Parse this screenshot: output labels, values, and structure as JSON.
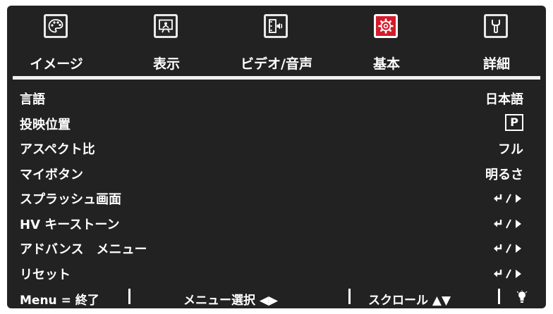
{
  "tabs": [
    {
      "label": "イメージ",
      "icon": "palette-icon",
      "active": false
    },
    {
      "label": "表示",
      "icon": "display-screen-icon",
      "active": false
    },
    {
      "label": "ビデオ/音声",
      "icon": "film-audio-icon",
      "active": false
    },
    {
      "label": "基本",
      "icon": "gear-icon",
      "active": true
    },
    {
      "label": "詳細",
      "icon": "wrench-icon",
      "active": false
    }
  ],
  "rows": [
    {
      "label": "言語",
      "value": "日本語"
    },
    {
      "label": "投映位置",
      "value": "P"
    },
    {
      "label": "アスペクト比",
      "value": "フル"
    },
    {
      "label": "マイボタン",
      "value": "明るさ"
    },
    {
      "label": "スプラッシュ画面",
      "value": "↵/▸"
    },
    {
      "label": "HV キーストーン",
      "value": "↵/▸"
    },
    {
      "label": "アドバンス　メニュー",
      "value": "↵/▸"
    },
    {
      "label": "リセット",
      "value": "↵/▸"
    }
  ],
  "footer": {
    "menu_exit": "Menu = 終了",
    "menu_select": "メニュー選択 ◀▶",
    "scroll": "スクロール ▲▼"
  },
  "colors": {
    "background": "#222222",
    "active_tab": "#d21c2c",
    "text": "#ffffff"
  }
}
